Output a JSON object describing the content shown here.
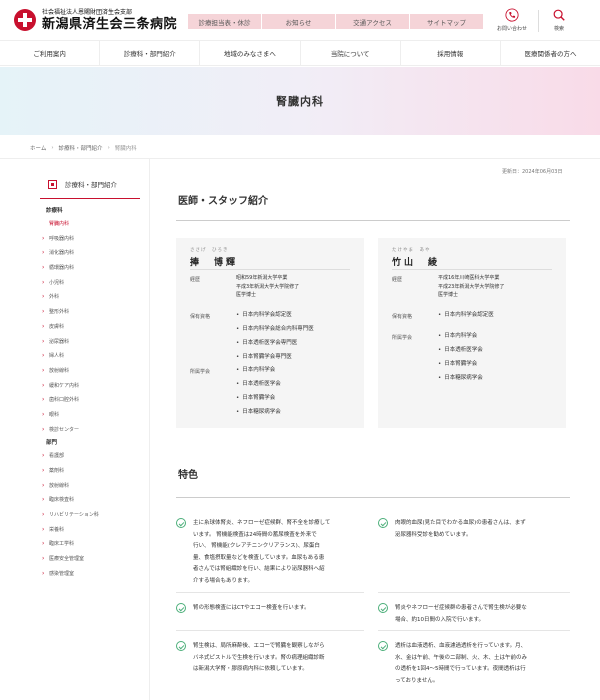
{
  "logo": {
    "sub": "社会福祉法人恩賜財団済生会支部",
    "main": "新潟県済生会三条病院",
    "mark": "saiseikai-cross-logo"
  },
  "top_links": [
    "診療担当表・休診",
    "お知らせ",
    "交通アクセス",
    "サイトマップ"
  ],
  "util": {
    "contact": "お問い合わせ",
    "search": "検索"
  },
  "gnav": [
    "ご利用案内",
    "診療科・部門紹介",
    "地域のみなさまへ",
    "当院について",
    "採用情報",
    "医療関係者の方へ"
  ],
  "hero": {
    "title": "腎臓内科"
  },
  "breadcrumb": {
    "home": "ホーム",
    "parent": "診療科・部門紹介",
    "current": "腎臓内科"
  },
  "sidebar": {
    "heading": "診療科・部門紹介",
    "cat1": "診療科",
    "dept_items": [
      "腎臓内科",
      "呼吸器内科",
      "消化器内科",
      "循環器内科",
      "小児科",
      "外科",
      "整形外科",
      "皮膚科",
      "泌尿器科",
      "婦人科",
      "放射線科",
      "緩和ケア内科",
      "歯科口腔外科",
      "眼科",
      "検診センター"
    ],
    "cat2": "部門",
    "section_items": [
      "看護部",
      "薬剤科",
      "放射線科",
      "臨床検査科",
      "リハビリテーション科",
      "栄養科",
      "臨床工学科",
      "医療安全管理室",
      "感染管理室"
    ]
  },
  "updated": "更新日：2024年06月03日",
  "staff": {
    "heading": "医師・スタッフ紹介",
    "doctors": [
      {
        "ruby": "ささげ　ひろき",
        "name": "捧　博輝",
        "career_label": "経歴",
        "career": [
          "昭和59年新潟大学卒業",
          "平成3年新潟大学大学院修了",
          "医学博士"
        ],
        "qual_label": "保有資格",
        "quals": [
          "日本内科学会認定医",
          "日本内科学会総合内科専門医",
          "日本透析医学会専門医",
          "日本腎臓学会専門医"
        ],
        "society_label": "所属学会",
        "societies": [
          "日本内科学会",
          "日本透析医学会",
          "日本腎臓学会",
          "日本糖尿病学会"
        ]
      },
      {
        "ruby": "たけやま　あや",
        "name": "竹山　綾",
        "career_label": "経歴",
        "career": [
          "平成16年川崎医科大学卒業",
          "平成23年新潟大学大学院修了",
          "医学博士"
        ],
        "qual_label": "保有資格",
        "quals": [
          "日本内科学会認定医"
        ],
        "society_label": "所属学会",
        "societies": [
          "日本内科学会",
          "日本透析医学会",
          "日本腎臓学会",
          "日本糖尿病学会"
        ]
      }
    ]
  },
  "features": {
    "heading": "特色",
    "items": [
      [
        "主に糸球体腎炎、ネフローゼ症候群、腎不全を診療して",
        "います。 腎機能検査は24時間の蓄尿検査を外来で",
        "行い、 腎機能(クレアチニンクリアランス)、尿蛋白",
        "量、食塩摂取量などを検査しています。血尿もある患",
        "者さんでは腎組織診を行い、結果により泌尿器科へ紹",
        "介する場合もあります。"
      ],
      [
        "肉眼的血尿(見た目でわかる血尿)の患者さんは、まず",
        "泌尿器科受診を勧めています。"
      ],
      [
        "腎の形態検査にはCTやエコー検査を行います。"
      ],
      [
        "腎炎やネフローゼ症候群の患者さんで腎生検が必要な",
        "場合、約10日間の入院で行います。"
      ],
      [
        "腎生検は、局所麻酔後、エコーで腎臓を観察しながら",
        "バネ式ピストルで生検を行います。腎の病理組織診断",
        "は新潟大学腎・膠原病内科に依頼しています。"
      ],
      [
        "透析は血液透析、血液濾過透析を行っています。月、",
        "水、金は午前、午後の二部制、火、木、土は午前のみ",
        "の透析を1回4～5時間で行っています。夜間透析は行",
        "っておりません。"
      ]
    ]
  }
}
